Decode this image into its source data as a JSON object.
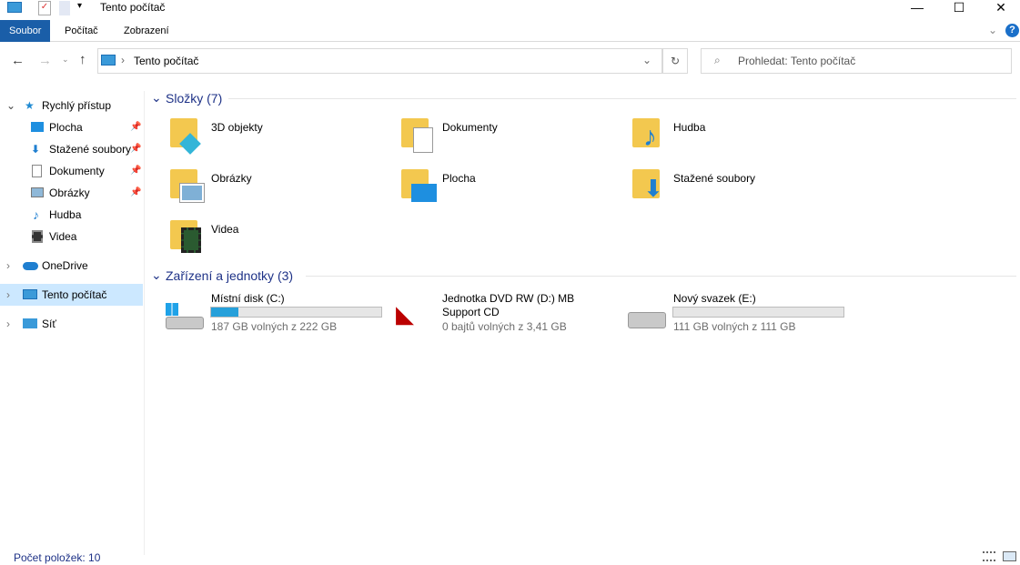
{
  "window": {
    "title": "Tento počítač",
    "minimize": "—",
    "maximize": "☐",
    "close": "✕"
  },
  "ribbon": {
    "tabs": [
      "Soubor",
      "Počítač",
      "Zobrazení"
    ]
  },
  "address": {
    "path": "Tento počítač",
    "search_placeholder": "Prohledat: Tento počítač"
  },
  "nav": {
    "items": [
      {
        "label": "Rychlý přístup",
        "icon": "star-icon",
        "level": 0
      },
      {
        "label": "Plocha",
        "icon": "desktop-icon",
        "level": 1,
        "pinned": true
      },
      {
        "label": "Stažené soubory",
        "icon": "download-icon",
        "level": 1,
        "pinned": true
      },
      {
        "label": "Dokumenty",
        "icon": "document-icon",
        "level": 1,
        "pinned": true
      },
      {
        "label": "Obrázky",
        "icon": "picture-icon",
        "level": 1,
        "pinned": true
      },
      {
        "label": "Hudba",
        "icon": "music-icon",
        "level": 1
      },
      {
        "label": "Videa",
        "icon": "video-icon",
        "level": 1
      },
      {
        "label": "OneDrive",
        "icon": "cloud-icon",
        "level": 0
      },
      {
        "label": "Tento počítač",
        "icon": "computer-icon",
        "level": 0,
        "selected": true
      },
      {
        "label": "Síť",
        "icon": "network-icon",
        "level": 0
      }
    ]
  },
  "folders": {
    "heading": "Složky (7)",
    "items": [
      "3D objekty",
      "Dokumenty",
      "Hudba",
      "Obrázky",
      "Plocha",
      "Stažené soubory",
      "Videa"
    ]
  },
  "drives": {
    "heading": "Zařízení a jednotky (3)",
    "items": [
      {
        "name": "Místní disk (C:)",
        "info": "187 GB volných z 222 GB",
        "used_percent": 16
      },
      {
        "name": "Jednotka DVD RW (D:) MB Support CD",
        "info": "0 bajtů volných z 3,41 GB"
      },
      {
        "name": "Nový svazek (E:)",
        "info": "111 GB volných z 111 GB",
        "used_percent": 0
      }
    ]
  },
  "status": {
    "count": "Počet položek: 10"
  },
  "colors": {
    "accent": "#1a5ea8",
    "bar": "#26a0da",
    "selected": "#cce8ff"
  }
}
